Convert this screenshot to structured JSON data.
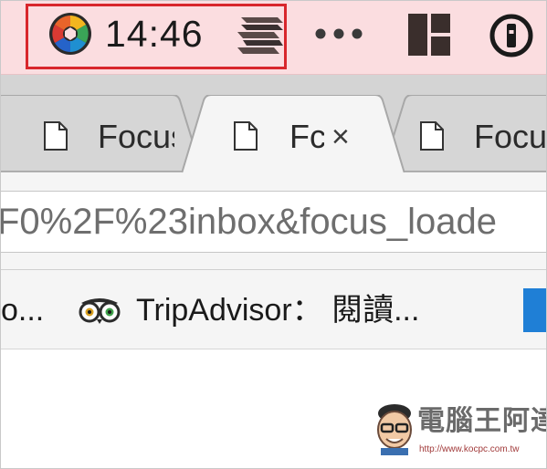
{
  "menubar": {
    "clock": "14:46",
    "apps": [
      {
        "icon": "aperture-icon"
      },
      {
        "icon": "stacked-layers-icon"
      },
      {
        "icon": "more-dots-icon"
      },
      {
        "icon": "window-grid-icon"
      },
      {
        "icon": "1password-icon"
      }
    ],
    "highlight_color": "#d8262c"
  },
  "tabs": [
    {
      "title": "Focus",
      "active": false
    },
    {
      "title": "Fc",
      "active": true,
      "close": "×"
    },
    {
      "title": "Focus",
      "active": false
    }
  ],
  "address_bar": {
    "url_visible": "F0%2F%23inbox&focus_loade"
  },
  "bookmarks": [
    {
      "label": "o..."
    },
    {
      "label": "TripAdvisor： 閱讀...",
      "icon": "tripadvisor-owl-icon"
    }
  ],
  "watermark": {
    "title": "電腦王阿達",
    "url": "http://www.kocpc.com.tw"
  },
  "colors": {
    "menubar_bg": "#fbdde0",
    "tabstrip_bg": "#d4d4d4",
    "active_tab_bg": "#f5f5f5",
    "bookmark_blue": "#1f7fd6"
  }
}
